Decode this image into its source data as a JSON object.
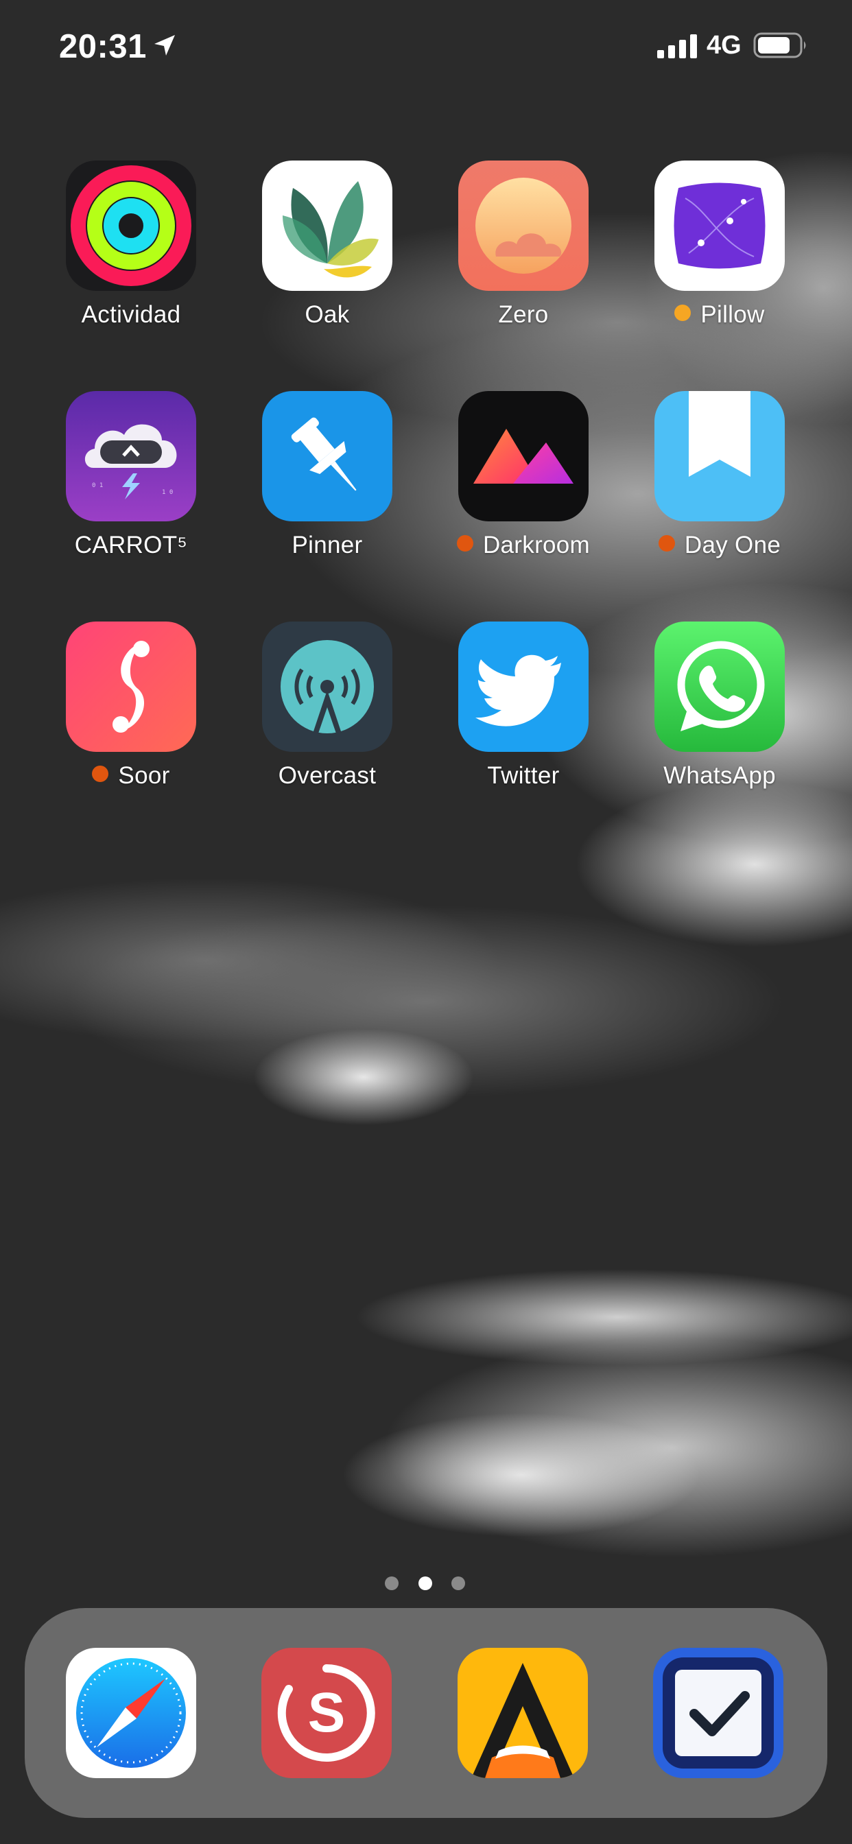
{
  "status_bar": {
    "time": "20:31",
    "network": "4G",
    "location_icon": "location-arrow-icon",
    "signal_icon": "cellular-signal-icon",
    "battery_icon": "battery-icon"
  },
  "home_apps": [
    {
      "label": "Actividad",
      "icon": "activity-rings-icon",
      "dot": false
    },
    {
      "label": "Oak",
      "icon": "oak-leaves-icon",
      "dot": false
    },
    {
      "label": "Zero",
      "icon": "zero-sunrise-icon",
      "dot": false
    },
    {
      "label": "Pillow",
      "icon": "pillow-icon",
      "dot": true,
      "dot_color": "#f6a623"
    },
    {
      "label": "CARROT⁵",
      "icon": "carrot-weather-cloud-icon",
      "dot": false
    },
    {
      "label": "Pinner",
      "icon": "pushpin-icon",
      "dot": false
    },
    {
      "label": "Darkroom",
      "icon": "darkroom-mountains-icon",
      "dot": true,
      "dot_color": "#e0560f"
    },
    {
      "label": "Day One",
      "icon": "bookmark-icon",
      "dot": true,
      "dot_color": "#e0560f"
    },
    {
      "label": "Soor",
      "icon": "soor-s-icon",
      "dot": true,
      "dot_color": "#e0560f"
    },
    {
      "label": "Overcast",
      "icon": "podcast-tower-icon",
      "dot": false
    },
    {
      "label": "Twitter",
      "icon": "twitter-bird-icon",
      "dot": false
    },
    {
      "label": "WhatsApp",
      "icon": "whatsapp-phone-icon",
      "dot": false
    }
  ],
  "page_indicator": {
    "pages": 3,
    "current": 2
  },
  "dock_apps": [
    {
      "icon": "safari-compass-icon"
    },
    {
      "icon": "streaks-s-icon"
    },
    {
      "icon": "ulysses-butterfly-icon"
    },
    {
      "icon": "omnifocus-checkbox-icon"
    }
  ],
  "colors": {
    "dot_orange": "#e0560f",
    "dot_yellow": "#f6a623"
  }
}
